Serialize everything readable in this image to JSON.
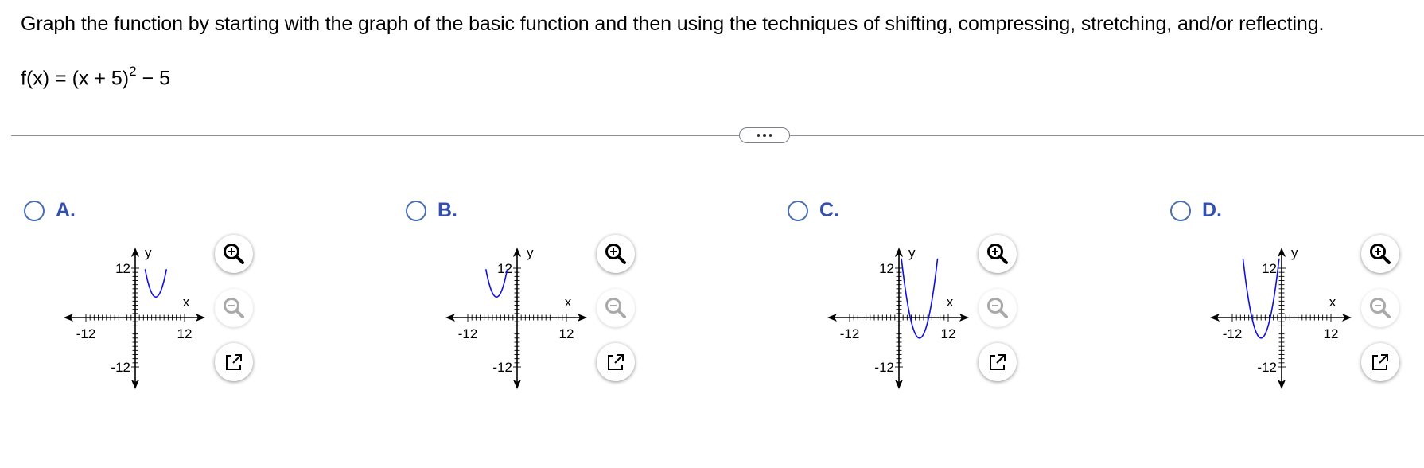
{
  "question": {
    "prompt": "Graph the function by starting with the graph of the basic function and then using the techniques of shifting, compressing, stretching, and/or reflecting.",
    "function_prefix": "f(x) = (x + 5)",
    "function_exponent": "2",
    "function_suffix": " − 5"
  },
  "more_button_icon": "ellipsis-icon",
  "colors": {
    "curve": "#1010e0",
    "option_letter": "#3350b0",
    "radio_border": "#4b6fb0",
    "axis": "#000000",
    "divider": "#8a8f98"
  },
  "options": [
    {
      "letter": "A.",
      "chart_data": {
        "type": "line",
        "x_axis_label": "x",
        "y_axis_label": "y",
        "x_ticks": [
          "-12",
          "12"
        ],
        "y_ticks": [
          "12",
          "-12"
        ],
        "xlim": [
          -12,
          12
        ],
        "ylim": [
          -12,
          12
        ],
        "curve": {
          "vertex": [
            5,
            5
          ],
          "a": 1,
          "x_range": [
            2.4,
            7.6
          ]
        },
        "zoom_in_icon": "zoom-in-icon",
        "zoom_out_icon": "zoom-out-icon",
        "popout_icon": "external-link-icon"
      }
    },
    {
      "letter": "B.",
      "chart_data": {
        "type": "line",
        "x_axis_label": "x",
        "y_axis_label": "y",
        "x_ticks": [
          "-12",
          "12"
        ],
        "y_ticks": [
          "12",
          "-12"
        ],
        "xlim": [
          -12,
          12
        ],
        "ylim": [
          -12,
          12
        ],
        "curve": {
          "vertex": [
            -5,
            5
          ],
          "a": 1,
          "x_range": [
            -7.6,
            -2.4
          ]
        },
        "zoom_in_icon": "zoom-in-icon",
        "zoom_out_icon": "zoom-out-icon",
        "popout_icon": "external-link-icon"
      }
    },
    {
      "letter": "C.",
      "chart_data": {
        "type": "line",
        "x_axis_label": "x",
        "y_axis_label": "y",
        "x_ticks": [
          "-12",
          "12"
        ],
        "y_ticks": [
          "12",
          "-12"
        ],
        "xlim": [
          -12,
          12
        ],
        "ylim": [
          -12,
          12
        ],
        "curve": {
          "vertex": [
            5,
            -5
          ],
          "a": 1,
          "x_range": [
            0.6,
            9.4
          ]
        },
        "zoom_in_icon": "zoom-in-icon",
        "zoom_out_icon": "zoom-out-icon",
        "popout_icon": "external-link-icon"
      }
    },
    {
      "letter": "D.",
      "chart_data": {
        "type": "line",
        "x_axis_label": "x",
        "y_axis_label": "y",
        "x_ticks": [
          "-12",
          "12"
        ],
        "y_ticks": [
          "12",
          "-12"
        ],
        "xlim": [
          -12,
          12
        ],
        "ylim": [
          -12,
          12
        ],
        "curve": {
          "vertex": [
            -5,
            -5
          ],
          "a": 1,
          "x_range": [
            -9.4,
            -0.6
          ]
        },
        "zoom_in_icon": "zoom-in-icon",
        "zoom_out_icon": "zoom-out-icon",
        "popout_icon": "external-link-icon"
      }
    }
  ]
}
